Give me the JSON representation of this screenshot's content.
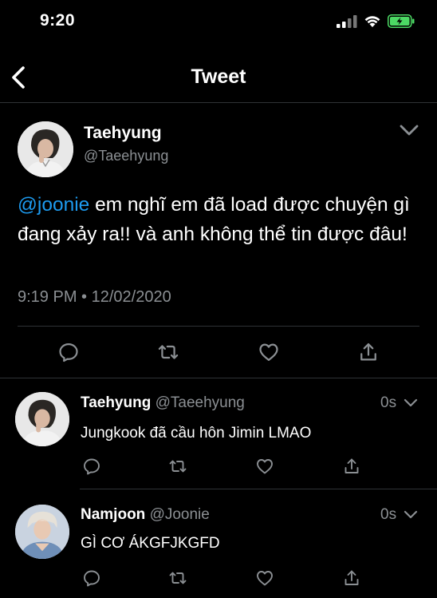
{
  "status_bar": {
    "time": "9:20"
  },
  "header": {
    "title": "Tweet"
  },
  "main_tweet": {
    "author_name": "Taehyung",
    "author_handle": "@Taeehyung",
    "mention": "@joonie",
    "text": " em nghĩ em đã load được chuyện gì đang xảy ra!! và anh không thể tin được đâu!",
    "timestamp": "9:19 PM • 12/02/2020"
  },
  "replies": [
    {
      "author_name": "Taehyung",
      "author_handle": "@Taeehyung",
      "time": "0s",
      "text": "Jungkook đã cầu hôn Jimin LMAO"
    },
    {
      "author_name": "Namjoon",
      "author_handle": "@Joonie",
      "time": "0s",
      "text": "GÌ CƠ ÁKGFJKGFD"
    }
  ],
  "icons": [
    "back-arrow-icon",
    "chevron-down-icon",
    "reply-icon",
    "retweet-icon",
    "like-icon",
    "share-icon",
    "signal-icon",
    "wifi-icon",
    "battery-icon"
  ],
  "colors": {
    "background": "#000000",
    "mention": "#1d9bf0",
    "muted": "#8b8f93",
    "divider": "#2f3336",
    "battery": "#4cd964"
  }
}
